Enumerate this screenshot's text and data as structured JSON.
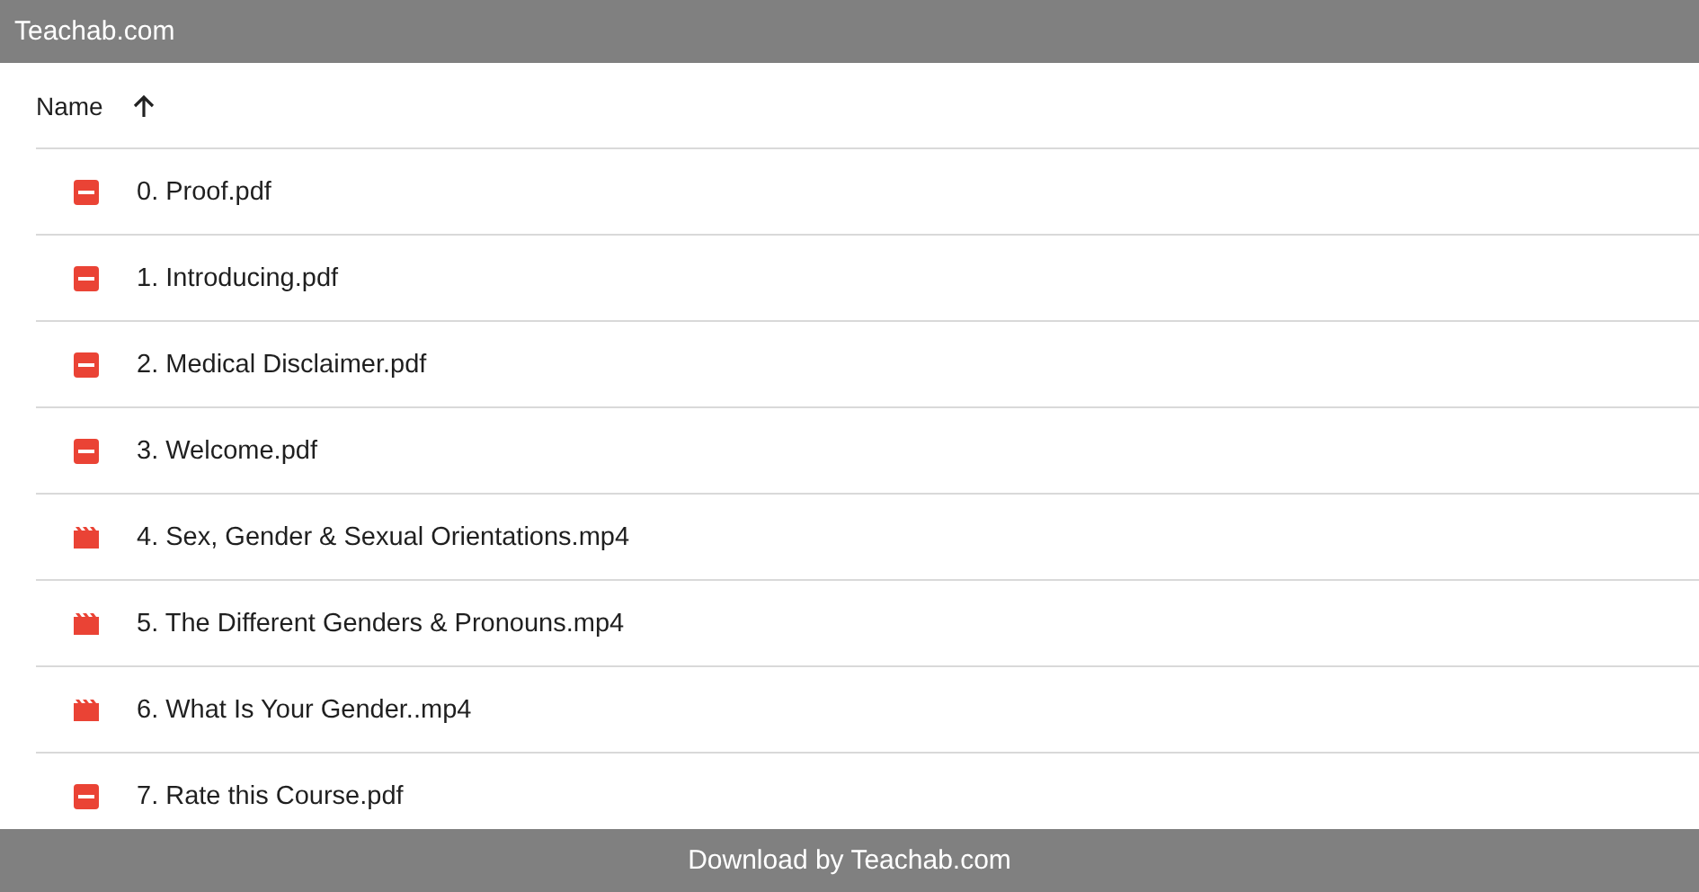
{
  "header": {
    "title": "Teachab.com"
  },
  "list": {
    "column": "Name",
    "sort_ascending": true,
    "rows": [
      {
        "name": "0. Proof.pdf",
        "kind": "pdf"
      },
      {
        "name": "1. Introducing.pdf",
        "kind": "pdf"
      },
      {
        "name": "2. Medical Disclaimer.pdf",
        "kind": "pdf"
      },
      {
        "name": "3. Welcome.pdf",
        "kind": "pdf"
      },
      {
        "name": "4. Sex, Gender & Sexual Orientations.mp4",
        "kind": "video"
      },
      {
        "name": "5. The Different Genders & Pronouns.mp4",
        "kind": "video"
      },
      {
        "name": "6. What Is Your Gender..mp4",
        "kind": "video"
      },
      {
        "name": "7. Rate this Course.pdf",
        "kind": "pdf"
      }
    ]
  },
  "footer": {
    "text": "Download by Teachab.com"
  }
}
